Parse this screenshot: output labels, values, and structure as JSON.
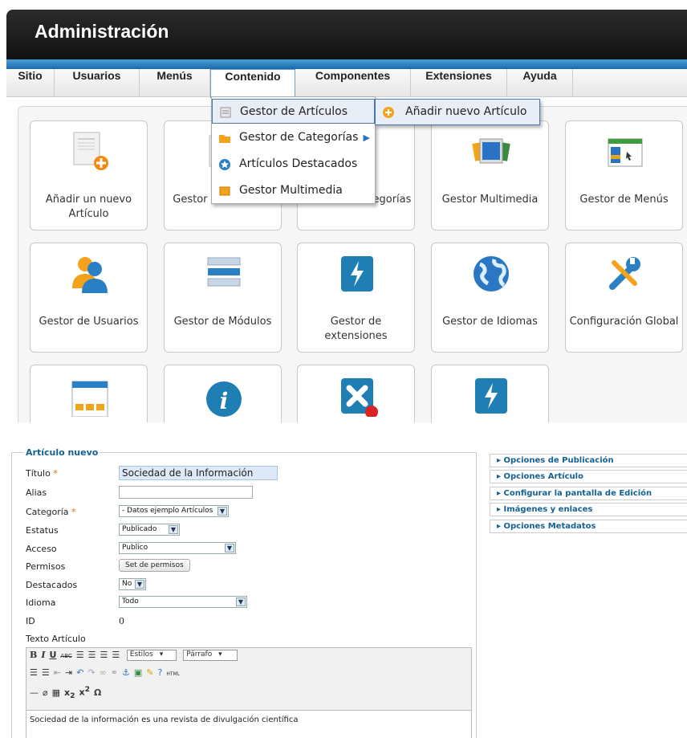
{
  "app": {
    "title": "Administración"
  },
  "menu": [
    "Sitio",
    "Usuarios",
    "Menús",
    "Contenido",
    "Componentes",
    "Extensiones",
    "Ayuda"
  ],
  "dropdown": {
    "items": [
      "Gestor de Artículos",
      "Gestor de Categorías",
      "Artículos Destacados",
      "Gestor Multimedia"
    ],
    "submenu": "Añadir nuevo Artículo"
  },
  "tiles": [
    "Añadir un nuevo Artículo",
    "Gestor de Artículos",
    "Gestor de Categorías",
    "Gestor Multimedia",
    "Gestor de Menús",
    "Gestor de Usuarios",
    "Gestor de Módulos",
    "Gestor de extensiones",
    "Gestor de Idiomas",
    "Configuración Global"
  ],
  "form": {
    "legend": "Artículo nuevo",
    "labels": {
      "titulo": "Título",
      "alias": "Alias",
      "categoria": "Categoría",
      "estatus": "Estatus",
      "acceso": "Acceso",
      "permisos": "Permisos",
      "destacados": "Destacados",
      "idioma": "Idioma",
      "id": "ID",
      "texto": "Texto Artículo"
    },
    "required_mark": "*",
    "titulo_value": "Sociedad de la Información",
    "alias_value": "",
    "categoria_value": "- Datos ejemplo Artículos",
    "estatus_value": "Publicado",
    "acceso_value": "Publico",
    "permisos_button": "Set de permisos",
    "destacados_value": "No",
    "idioma_value": "Todo",
    "id_value": "0",
    "toolbar": {
      "styles": "Estilos",
      "format": "Párrafo",
      "html": "HTML"
    },
    "content": "Sociedad de la información es una revista de divulgación científica"
  },
  "panels": [
    "Opciones de Publicación",
    "Opciones Artículo",
    "Configurar la pantalla de Edición",
    "Imágenes y enlaces",
    "Opciones Metadatos"
  ]
}
